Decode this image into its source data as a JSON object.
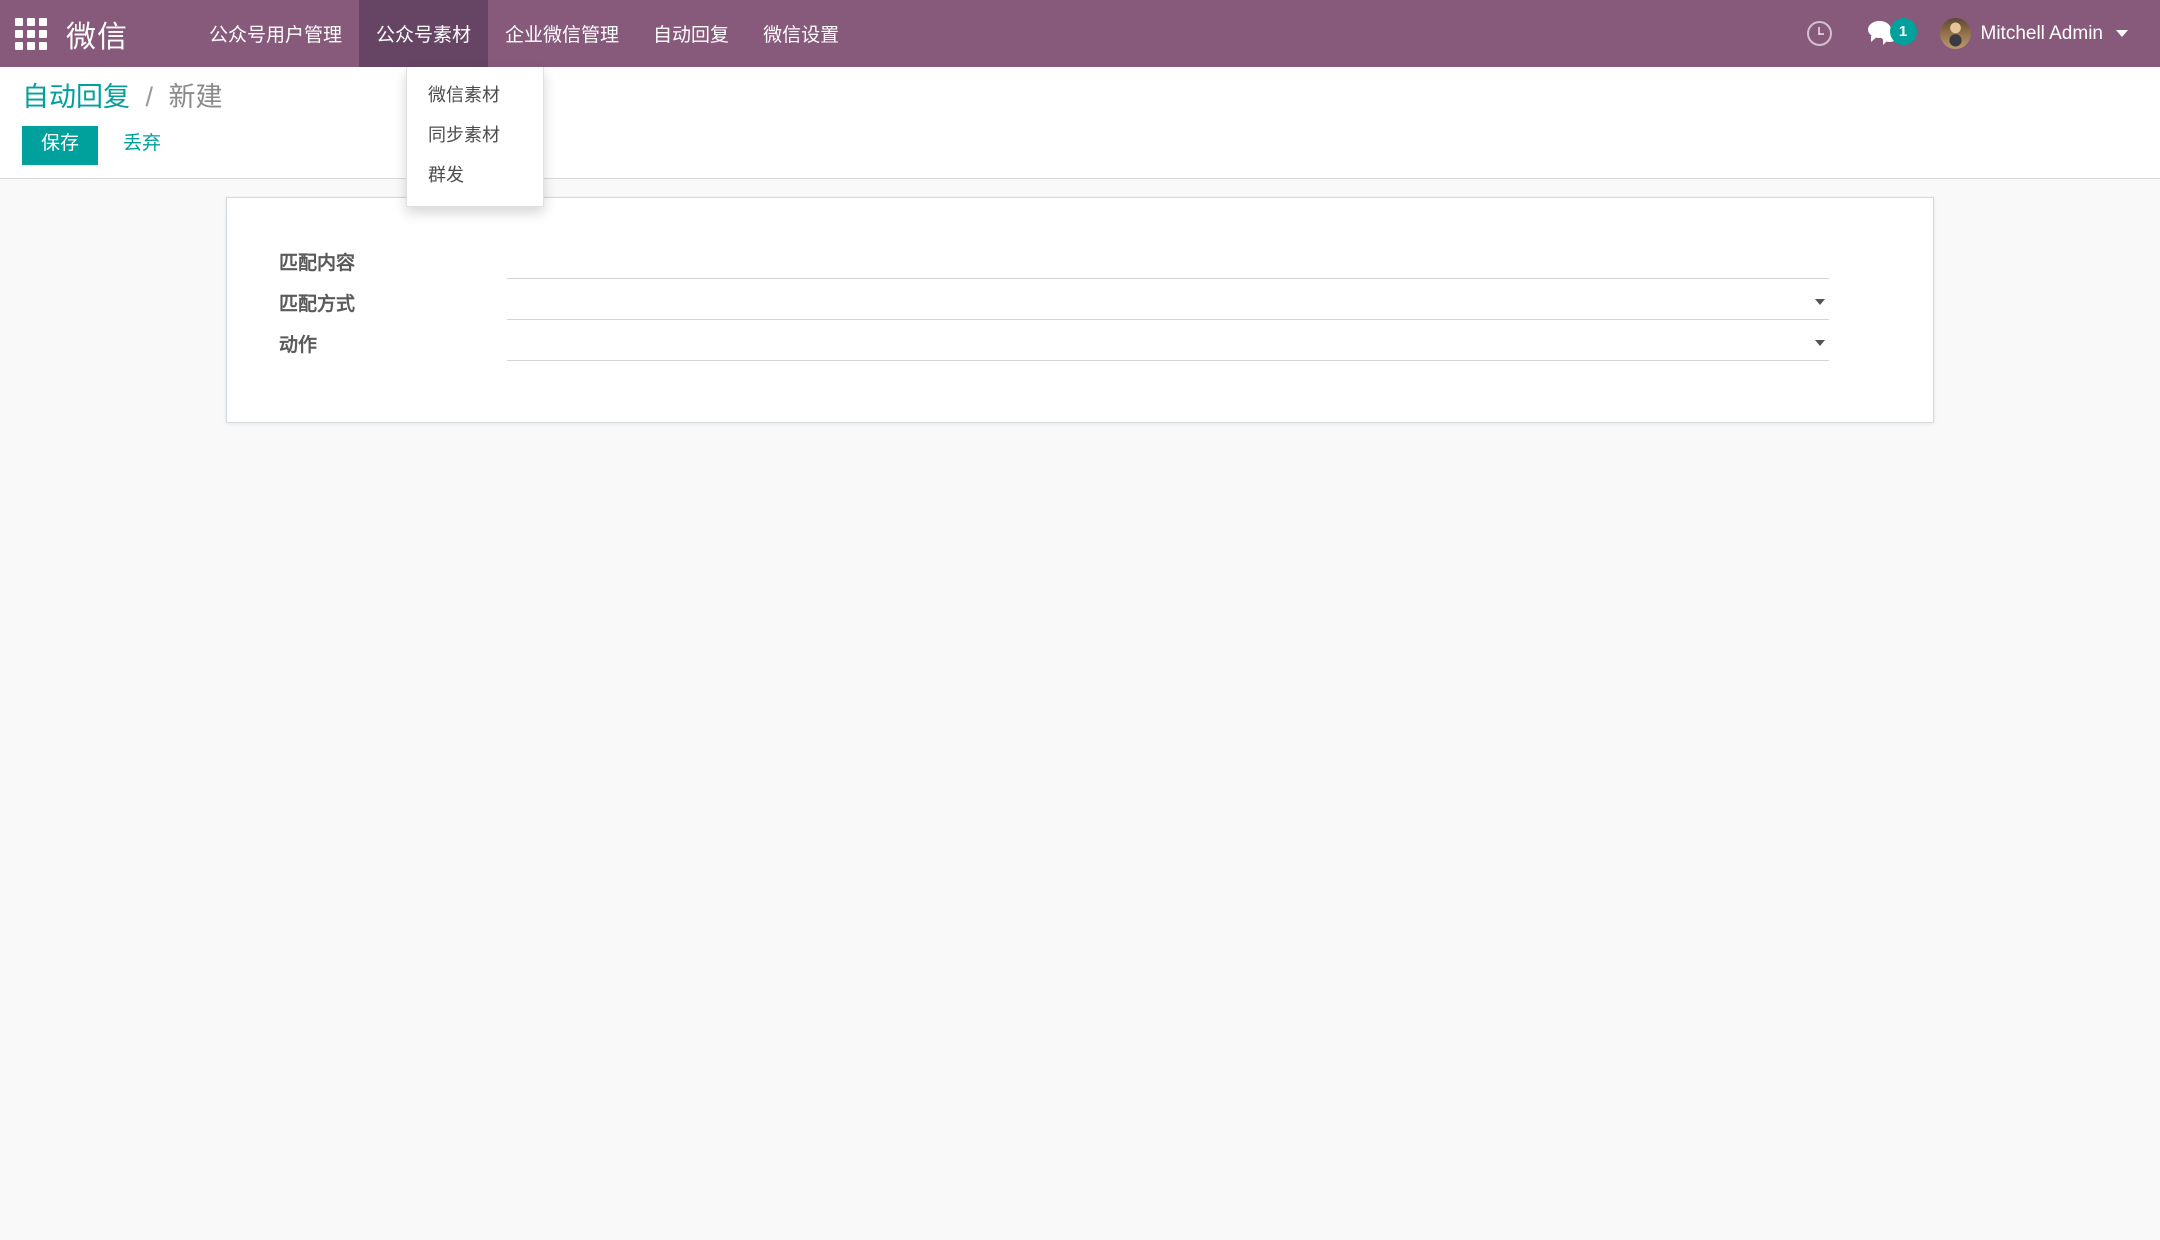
{
  "navbar": {
    "apps_icon": "apps-grid-icon",
    "brand": "微信",
    "menu_items": [
      {
        "label": "公众号用户管理",
        "active": false
      },
      {
        "label": "公众号素材",
        "active": true
      },
      {
        "label": "企业微信管理",
        "active": false
      },
      {
        "label": "自动回复",
        "active": false
      },
      {
        "label": "微信设置",
        "active": false
      }
    ],
    "clock_icon": "clock-icon",
    "chat_icon": "chat-bubbles-icon",
    "chat_badge_count": "1",
    "user_name": "Mitchell Admin",
    "caret_icon": "chevron-down-icon"
  },
  "dropdown": {
    "items": [
      {
        "label": "微信素材"
      },
      {
        "label": "同步素材"
      },
      {
        "label": "群发"
      }
    ]
  },
  "control_panel": {
    "breadcrumb_root": "自动回复",
    "breadcrumb_separator": "/",
    "breadcrumb_current": "新建",
    "save_label": "保存",
    "discard_label": "丢弃"
  },
  "form": {
    "fields": [
      {
        "label": "匹配内容",
        "type": "text",
        "value": "",
        "placeholder": ""
      },
      {
        "label": "匹配方式",
        "type": "select",
        "value": "",
        "placeholder": ""
      },
      {
        "label": "动作",
        "type": "select",
        "value": "",
        "placeholder": ""
      }
    ]
  },
  "colors": {
    "navbar_bg": "#875A7B",
    "navbar_active_bg": "#654563",
    "accent_teal": "#00A09D",
    "page_bg": "#F9F9F9",
    "sheet_border": "#D4D9DE",
    "label_text": "#5A5A5A",
    "breadcrumb_current": "#8A8A8A"
  }
}
